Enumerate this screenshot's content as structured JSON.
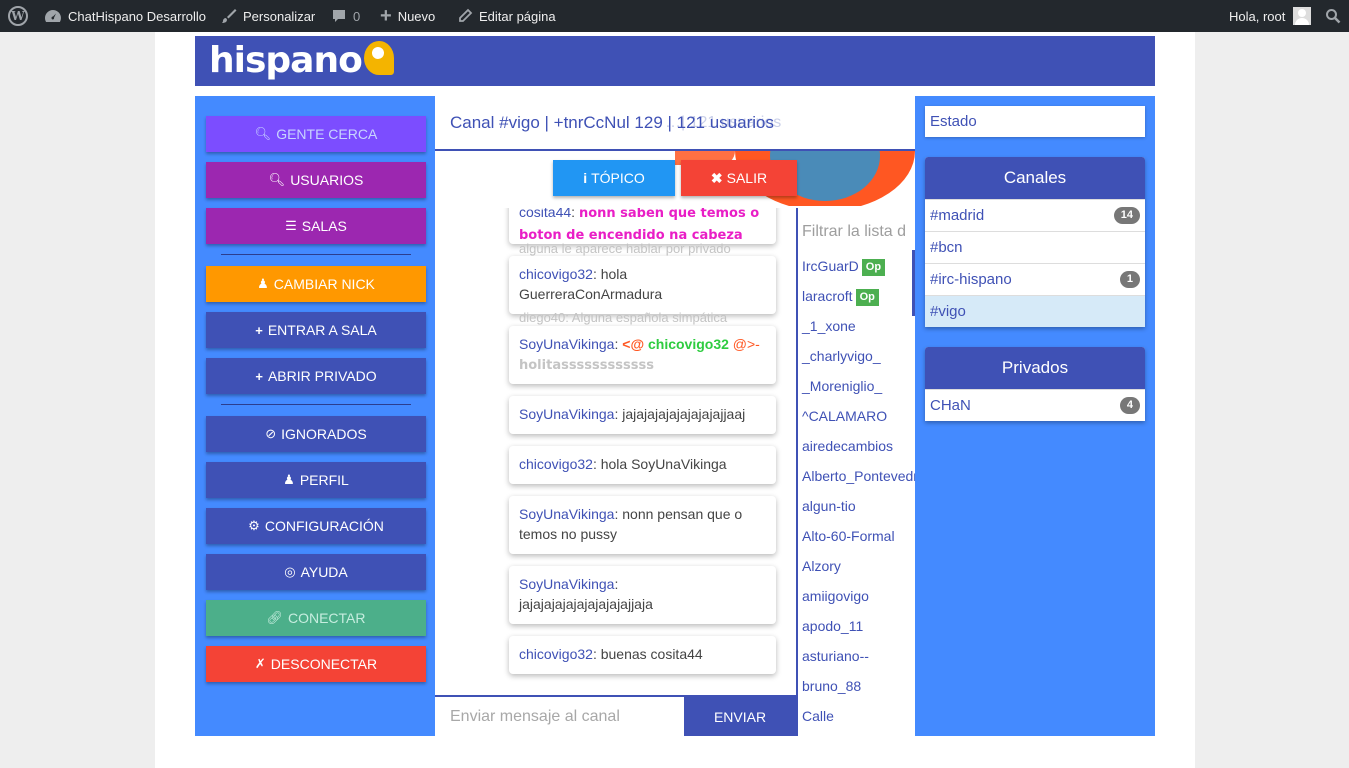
{
  "wpbar": {
    "site": "ChatHispano Desarrollo",
    "customize": "Personalizar",
    "comments": "0",
    "new": "Nuevo",
    "edit": "Editar página",
    "greeting": "Hola, root"
  },
  "logo": {
    "text": "hispano"
  },
  "left_menu": {
    "gente_cerca": "GENTE CERCA",
    "usuarios": "USUARIOS",
    "salas": "SALAS",
    "cambiar_nick": "CAMBIAR NICK",
    "entrar_sala": "ENTRAR A SALA",
    "abrir_privado": "ABRIR PRIVADO",
    "ignorados": "IGNORADOS",
    "perfil": "PERFIL",
    "configuracion": "CONFIGURACIÓN",
    "ayuda": "AYUDA",
    "conectar": "CONECTAR",
    "desconectar": "DESCONECTAR"
  },
  "channel": {
    "title": "Canal #vigo | +tnrCcNul 129 | 121 usuarios",
    "ghost": "…| 121 usuarios",
    "topic_btn": "TÓPICO",
    "leave_btn": "SALIR"
  },
  "messages": {
    "m0": {
      "nick": "cosita44",
      "text": "nonn saben que temos o boton de encendido na cabeza"
    },
    "ghost1": "alguna le aparece hablar por privado",
    "m1": {
      "nick": "chicovigo32",
      "text": "hola GuerreraConArmadura"
    },
    "ghost2": "diego40: Alguna española simpática",
    "m2": {
      "nick": "SoyUnaVikinga",
      "pre": "<@",
      "mention": "chicovigo32",
      "post": "@>-",
      "text": "holitassssssssssss"
    },
    "m3": {
      "nick": "SoyUnaVikinga",
      "text": "jajajajajajajajajajjaaj"
    },
    "m4": {
      "nick": "chicovigo32",
      "text": "hola SoyUnaVikinga"
    },
    "m5": {
      "nick": "SoyUnaVikinga",
      "text": "nonn pensan que o temos no pussy"
    },
    "m6": {
      "nick": "SoyUnaVikinga",
      "text": "jajajajajajajajajajajjaja"
    },
    "m7": {
      "nick": "chicovigo32",
      "text": "buenas cosita44"
    }
  },
  "input": {
    "placeholder": "Enviar mensaje al canal",
    "send": "ENVIAR"
  },
  "userlist": {
    "filter_placeholder": "Filtrar la lista d",
    "op_label": "Op",
    "users": [
      "IrcGuarD",
      "laracroft",
      "_1_xone",
      "_charlyvigo_",
      "_Moreniglio_",
      "^CALAMARO",
      "airedecambios",
      "Alberto_Pontevedra",
      "algun-tio",
      "Alto-60-Formal",
      "Alzory",
      "amiigovigo",
      "apodo_11",
      "asturiano--",
      "bruno_88",
      "Calle"
    ]
  },
  "right": {
    "estado": "Estado",
    "canales_title": "Canales",
    "canales": [
      {
        "name": "#madrid",
        "count": "14"
      },
      {
        "name": "#bcn",
        "count": ""
      },
      {
        "name": "#irc-hispano",
        "count": "1"
      },
      {
        "name": "#vigo",
        "count": ""
      }
    ],
    "privados_title": "Privados",
    "privados": [
      {
        "name": "CHaN",
        "count": "4"
      }
    ]
  },
  "colors": {
    "header": "#3f51b5",
    "sidebar": "#448aff",
    "gente_cerca": "#7c4dff",
    "purple": "#9c27b0",
    "orange": "#ff9800",
    "indigo": "#3f51b5",
    "conectar": "#4caf8a",
    "desconectar": "#f44336",
    "topic": "#2196f3",
    "salir": "#f44336",
    "op_badge": "#4caf50"
  }
}
